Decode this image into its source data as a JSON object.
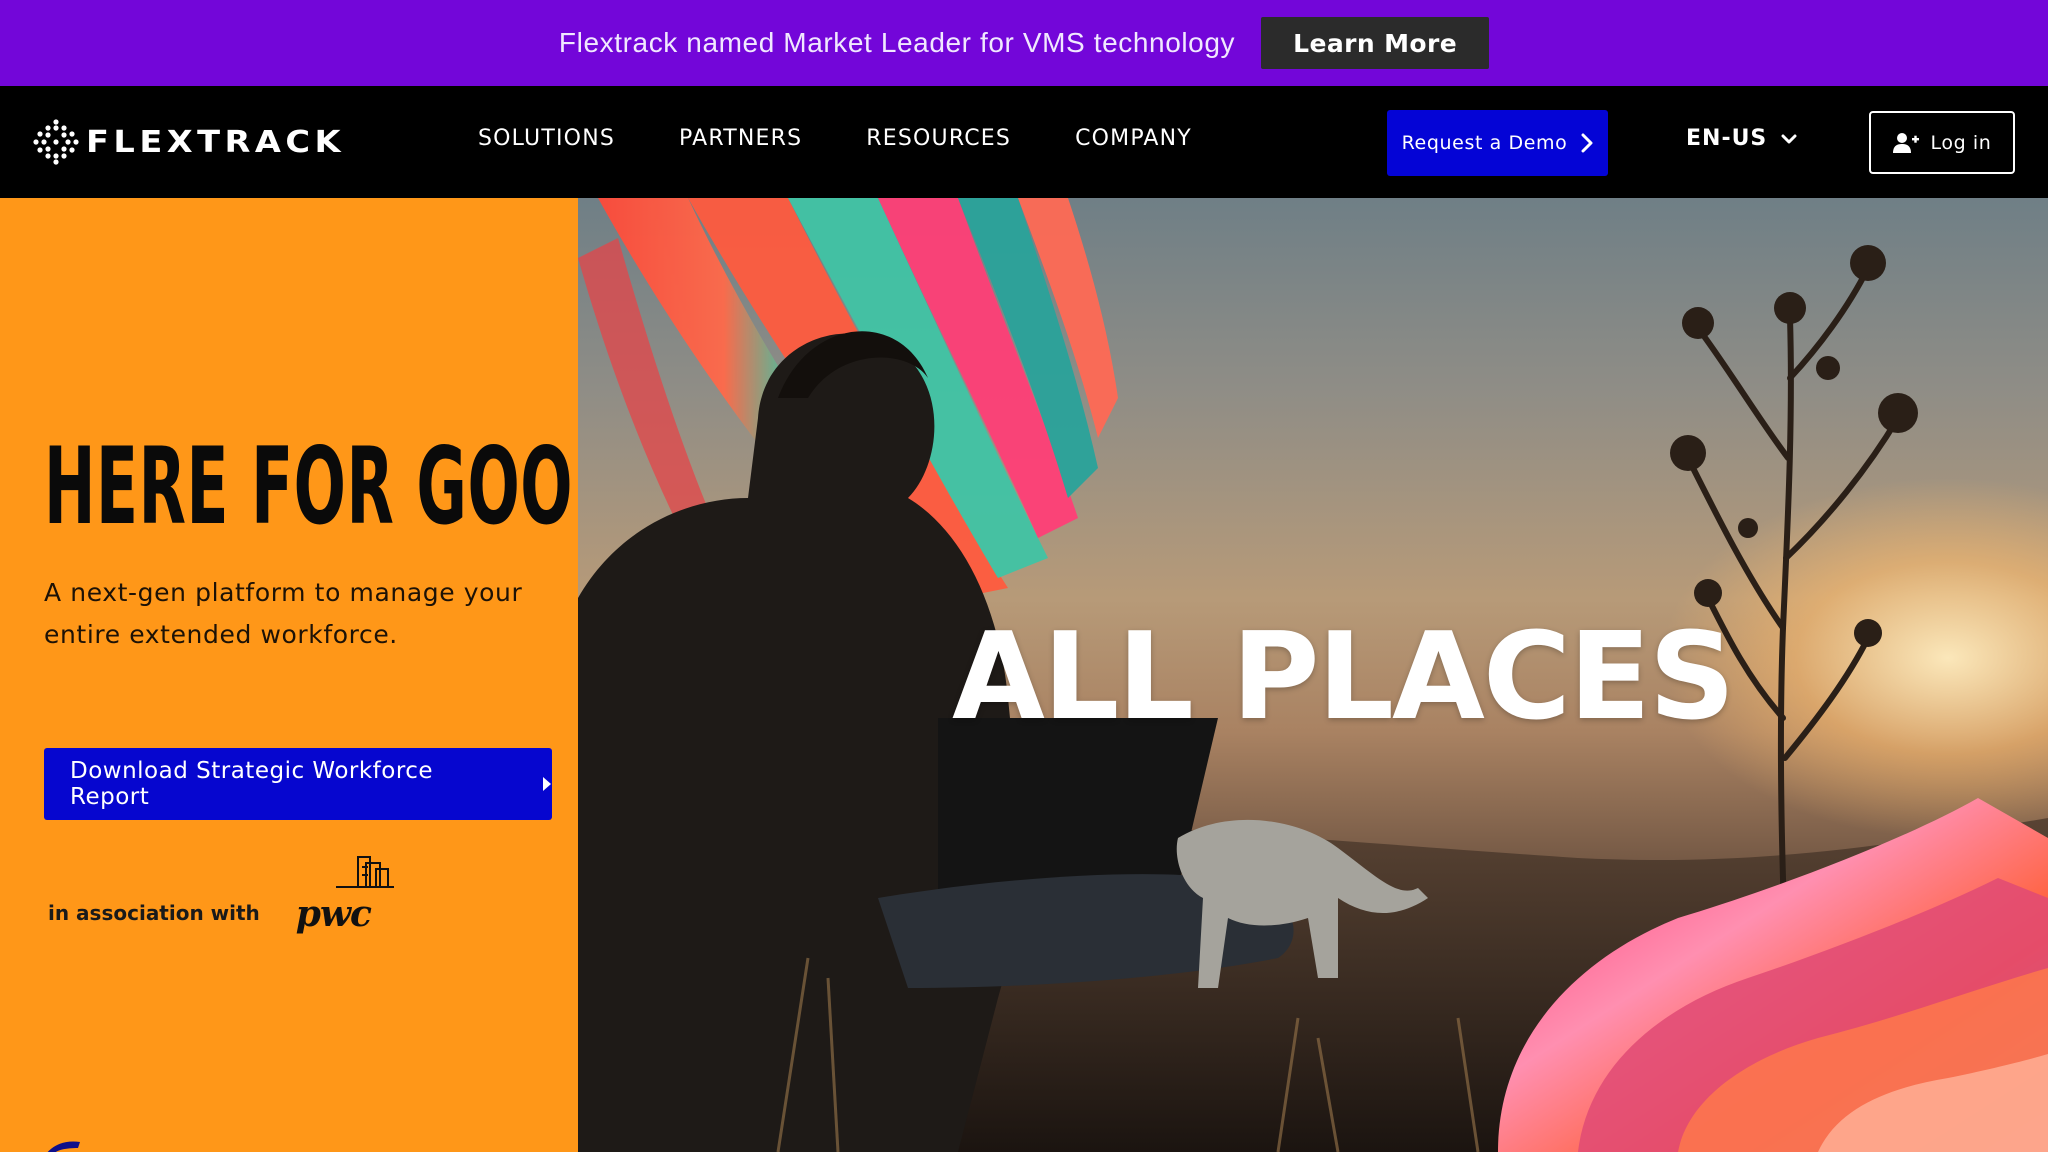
{
  "announcement": {
    "text": "Flextrack named Market Leader for VMS technology",
    "button_label": "Learn More",
    "background": "#7306d9"
  },
  "nav": {
    "logo_text": "FLEXTRACK",
    "menu": [
      "SOLUTIONS",
      "PARTNERS",
      "RESOURCES",
      "COMPANY"
    ],
    "demo_label": "Request a Demo",
    "language": "EN-US",
    "login_label": "Log in",
    "icons": [
      "flextrack-logo-icon",
      "chevron-right-icon",
      "chevron-down-icon",
      "user-plus-icon"
    ]
  },
  "hero": {
    "title": "HERE FOR GOOD.",
    "subtitle": "A next-gen platform to manage your entire extended workforce.",
    "cta_label": "Download Strategic Workforce Report",
    "association_text": "in association with",
    "partner_logo": "pwc",
    "image_headline": "ALL PLACES",
    "colors": {
      "left_panel": "#ff9718",
      "cta": "#0606cf",
      "demo": "#0404d6"
    }
  }
}
